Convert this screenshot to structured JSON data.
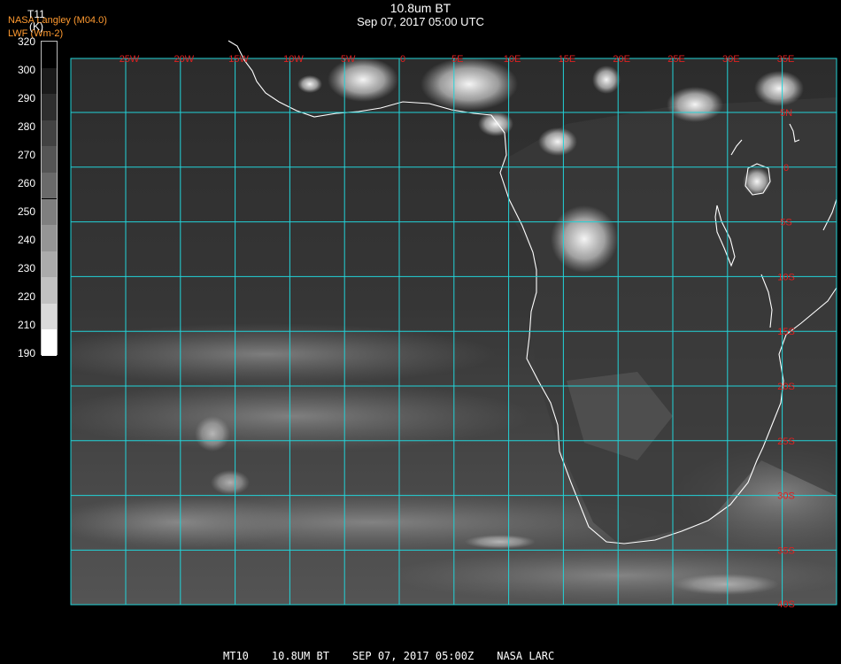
{
  "header": {
    "title": "10.8um BT",
    "subtitle": "Sep 07, 2017 05:00 UTC"
  },
  "source": {
    "line1": "NASA Langley (M04.0)",
    "line2": "LWF (Wm-2)"
  },
  "colorbar": {
    "variable": "T11",
    "unit": "(K)",
    "ticks": [
      "320",
      "300",
      "290",
      "280",
      "270",
      "260",
      "250",
      "240",
      "230",
      "220",
      "210",
      "190"
    ],
    "shades": [
      "#000000",
      "#1a1a1a",
      "#2e2e2e",
      "#424242",
      "#555555",
      "#6a6a6a",
      "#7f7f7f",
      "#959595",
      "#ababab",
      "#c2c2c2",
      "#dadada",
      "#ffffff"
    ]
  },
  "map": {
    "grid_color": "#22d3d8",
    "label_color": "#e02020",
    "coast_color": "#ffffff",
    "lon_labels": [
      "25W",
      "20W",
      "15W",
      "10W",
      "5W",
      "0",
      "5E",
      "10E",
      "15E",
      "20E",
      "25E",
      "30E",
      "35E"
    ],
    "lat_labels": [
      "5N",
      "0",
      "5S",
      "10S",
      "15S",
      "20S",
      "25S",
      "30S",
      "35S",
      "40S"
    ]
  },
  "footer": {
    "satellite": "MT10",
    "channel": "10.8UM BT",
    "datetime": "SEP 07, 2017 05:00Z",
    "org": "NASA LARC"
  }
}
